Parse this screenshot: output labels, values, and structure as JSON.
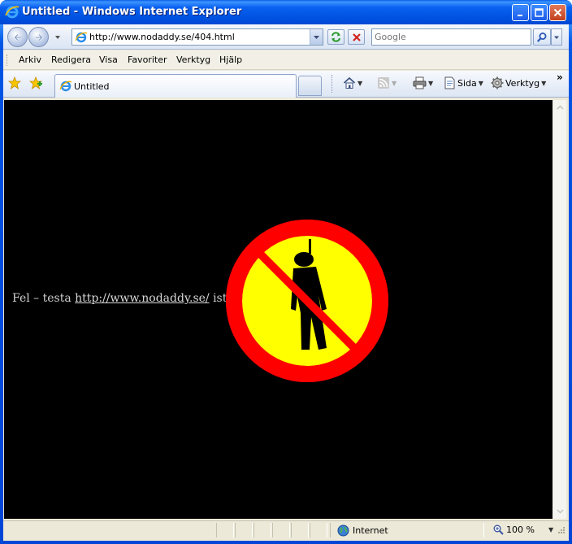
{
  "window": {
    "title": "Untitled - Windows Internet Explorer",
    "controls": {
      "minimize": "minimize-icon",
      "maximize": "maximize-icon",
      "close": "close-icon"
    }
  },
  "address_bar": {
    "url": "http://www.nodaddy.se/404.html",
    "search_placeholder": "Google"
  },
  "menu": {
    "items": [
      "Arkiv",
      "Redigera",
      "Visa",
      "Favoriter",
      "Verktyg",
      "Hjälp"
    ]
  },
  "tabs": {
    "active_title": "Untitled"
  },
  "command_bar": {
    "page_label": "Sida",
    "tools_label": "Verktyg",
    "overflow": "»"
  },
  "page": {
    "text_before": "Fel – testa ",
    "link_text": "http://www.nodaddy.se/",
    "text_after": " istället!",
    "background": "#000000",
    "sign_colors": {
      "ring": "#ff0000",
      "fill": "#ffff00",
      "figure": "#000000"
    }
  },
  "status_bar": {
    "zone": "Internet",
    "zoom": "100 %"
  },
  "colors": {
    "titlebar": "#0053e1",
    "frame": "#ece9d8",
    "toolbar": "#dbe5f4"
  }
}
